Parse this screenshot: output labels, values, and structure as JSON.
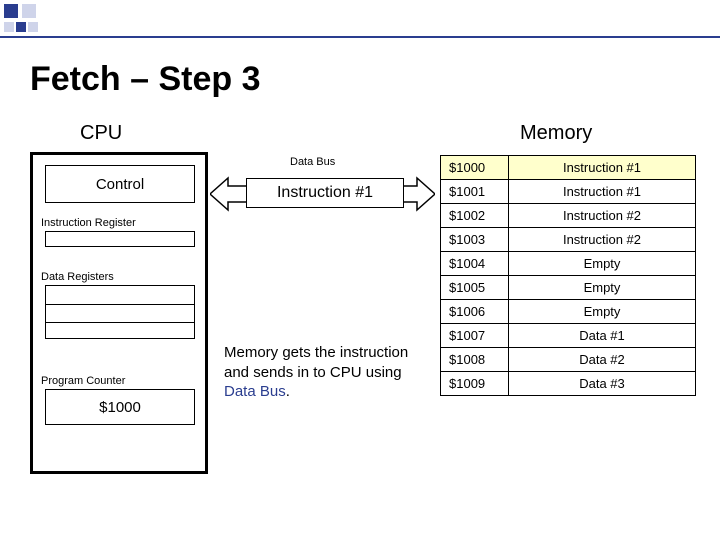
{
  "title": "Fetch – Step 3",
  "cpu_label": "CPU",
  "memory_label": "Memory",
  "cpu": {
    "control": "Control",
    "instruction_register_label": "Instruction Register",
    "data_registers_label": "Data Registers",
    "program_counter_label": "Program Counter",
    "program_counter_value": "$1000"
  },
  "bus": {
    "label": "Data Bus",
    "payload": "Instruction #1"
  },
  "caption": {
    "p1": "Memory gets the instruction and sends in to CPU using ",
    "kw": "Data Bus",
    "tail": "."
  },
  "memory": {
    "highlight_index": 0,
    "rows": [
      {
        "addr": "$1000",
        "val": "Instruction #1"
      },
      {
        "addr": "$1001",
        "val": "Instruction #1"
      },
      {
        "addr": "$1002",
        "val": "Instruction #2"
      },
      {
        "addr": "$1003",
        "val": "Instruction #2"
      },
      {
        "addr": "$1004",
        "val": "Empty"
      },
      {
        "addr": "$1005",
        "val": "Empty"
      },
      {
        "addr": "$1006",
        "val": "Empty"
      },
      {
        "addr": "$1007",
        "val": "Data #1"
      },
      {
        "addr": "$1008",
        "val": "Data #2"
      },
      {
        "addr": "$1009",
        "val": "Data #3"
      }
    ]
  }
}
